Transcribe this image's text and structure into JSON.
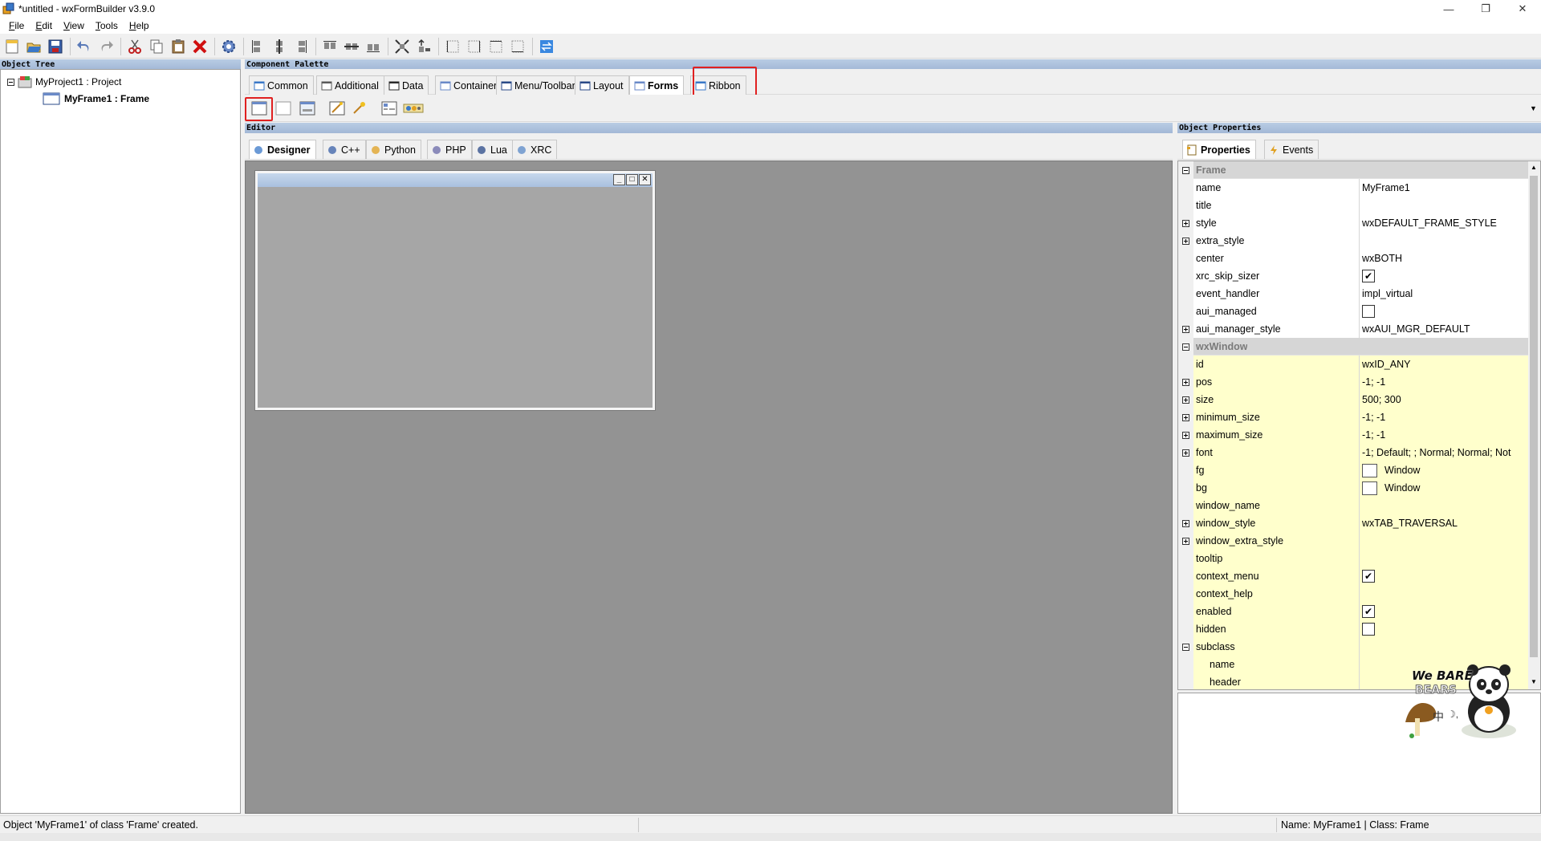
{
  "window": {
    "title": "*untitled - wxFormBuilder v3.9.0",
    "minimize": "—",
    "maximize": "❐",
    "close": "✕"
  },
  "menu": [
    {
      "accel": "F",
      "rest": "ile"
    },
    {
      "accel": "E",
      "rest": "dit"
    },
    {
      "accel": "V",
      "rest": "iew"
    },
    {
      "accel": "T",
      "rest": "ools"
    },
    {
      "accel": "H",
      "rest": "elp"
    }
  ],
  "panes": {
    "object_tree": "Object Tree",
    "component_palette": "Component Palette",
    "editor": "Editor",
    "object_properties": "Object Properties"
  },
  "tree": {
    "project": "MyProject1 : Project",
    "frame": "MyFrame1 : Frame"
  },
  "palette_tabs": [
    "Common",
    "Additional",
    "Data",
    "Containers",
    "Menu/Toolbar",
    "Layout",
    "Forms",
    "Ribbon"
  ],
  "palette_active": "Forms",
  "editor_tabs": [
    "Designer",
    "C++",
    "Python",
    "PHP",
    "Lua",
    "XRC"
  ],
  "editor_active": "Designer",
  "prop_tabs": [
    "Properties",
    "Events"
  ],
  "properties": {
    "frame_category": "Frame",
    "frame": [
      {
        "name": "name",
        "value": "MyFrame1",
        "expander": "none"
      },
      {
        "name": "title",
        "value": "",
        "expander": "none"
      },
      {
        "name": "style",
        "value": "wxDEFAULT_FRAME_STYLE",
        "expander": "plus"
      },
      {
        "name": "extra_style",
        "value": "",
        "expander": "plus"
      },
      {
        "name": "center",
        "value": "wxBOTH",
        "expander": "none"
      },
      {
        "name": "xrc_skip_sizer",
        "value": "",
        "expander": "none",
        "check": true
      },
      {
        "name": "event_handler",
        "value": "impl_virtual",
        "expander": "none"
      },
      {
        "name": "aui_managed",
        "value": "",
        "expander": "none",
        "check": false
      },
      {
        "name": "aui_manager_style",
        "value": "wxAUI_MGR_DEFAULT",
        "expander": "plus"
      }
    ],
    "window_category": "wxWindow",
    "window": [
      {
        "name": "id",
        "value": "wxID_ANY",
        "expander": "none"
      },
      {
        "name": "pos",
        "value": "-1; -1",
        "expander": "plus"
      },
      {
        "name": "size",
        "value": "500; 300",
        "expander": "plus"
      },
      {
        "name": "minimum_size",
        "value": "-1; -1",
        "expander": "plus"
      },
      {
        "name": "maximum_size",
        "value": "-1; -1",
        "expander": "plus"
      },
      {
        "name": "font",
        "value": "-1; Default; ; Normal; Normal; Not",
        "expander": "plus"
      },
      {
        "name": "fg",
        "value": "Window",
        "expander": "none",
        "color": true
      },
      {
        "name": "bg",
        "value": "Window",
        "expander": "none",
        "color": true
      },
      {
        "name": "window_name",
        "value": "",
        "expander": "none"
      },
      {
        "name": "window_style",
        "value": "wxTAB_TRAVERSAL",
        "expander": "plus"
      },
      {
        "name": "window_extra_style",
        "value": "",
        "expander": "plus"
      },
      {
        "name": "tooltip",
        "value": "",
        "expander": "none"
      },
      {
        "name": "context_menu",
        "value": "",
        "expander": "none",
        "check": true
      },
      {
        "name": "context_help",
        "value": "",
        "expander": "none"
      },
      {
        "name": "enabled",
        "value": "",
        "expander": "none",
        "check": true
      },
      {
        "name": "hidden",
        "value": "",
        "expander": "none",
        "check": false
      },
      {
        "name": "subclass",
        "value": "",
        "expander": "minus"
      },
      {
        "name": "name",
        "value": "",
        "expander": "none",
        "indent": true
      },
      {
        "name": "header",
        "value": "",
        "expander": "none",
        "indent": true
      }
    ]
  },
  "status": {
    "left": "Object 'MyFrame1' of class 'Frame' created.",
    "right": "Name: MyFrame1 | Class: Frame"
  },
  "sticker": {
    "line1": "We BARE",
    "line2": "BEARS",
    "badge": "中",
    "badge2": "☽,"
  },
  "colors": {
    "highlight": "#e02020",
    "window_prop_bg": "#ffffcc",
    "canvas": "#939393"
  }
}
